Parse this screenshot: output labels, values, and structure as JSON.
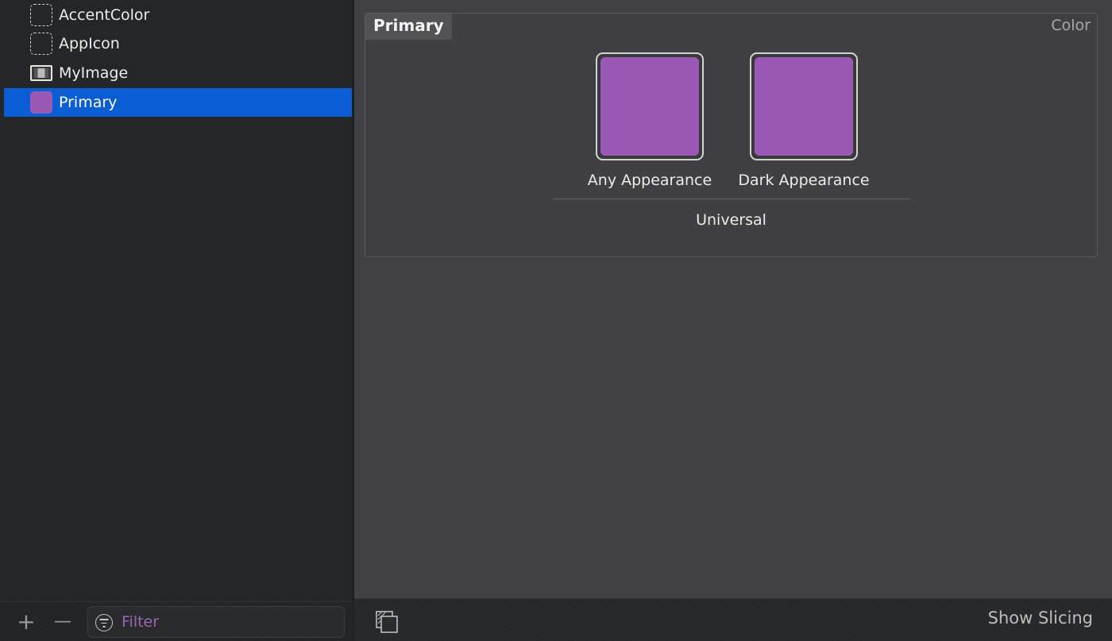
{
  "sidebar": {
    "items": [
      {
        "label": "AccentColor",
        "icon": "dashed-placeholder-icon",
        "selected": false
      },
      {
        "label": "AppIcon",
        "icon": "dashed-placeholder-icon",
        "selected": false
      },
      {
        "label": "MyImage",
        "icon": "image-set-icon",
        "selected": false
      },
      {
        "label": "Primary",
        "icon": "color-swatch-icon",
        "swatch_color": "#9b59b6",
        "selected": true
      }
    ],
    "footer": {
      "add_label": "+",
      "remove_label": "—",
      "filter_placeholder": "Filter",
      "filter_value": ""
    }
  },
  "editor": {
    "panel": {
      "title": "Primary",
      "type_label": "Color",
      "wells": [
        {
          "label": "Any Appearance",
          "color": "#9b59b6"
        },
        {
          "label": "Dark Appearance",
          "color": "#9b59b6"
        }
      ],
      "group_label": "Universal"
    },
    "footer": {
      "show_slicing_label": "Show Slicing"
    }
  },
  "colors": {
    "selection": "#0a5dd3",
    "swatch": "#9b59b6"
  }
}
